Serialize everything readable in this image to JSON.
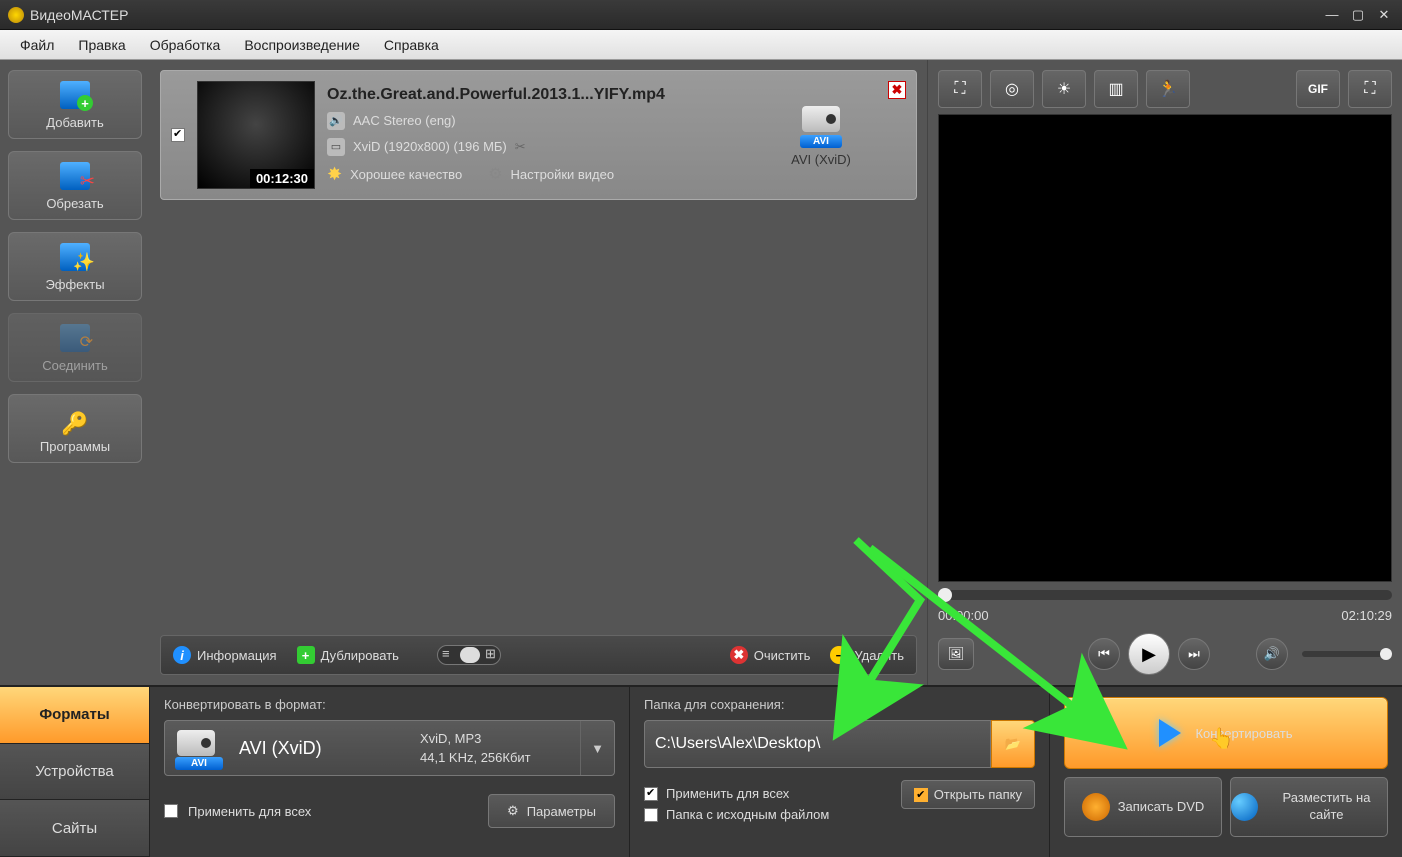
{
  "app": {
    "title": "ВидеоМАСТЕР"
  },
  "menu": {
    "file": "Файл",
    "edit": "Правка",
    "process": "Обработка",
    "playback": "Воспроизведение",
    "help": "Справка"
  },
  "sidebar": {
    "add": "Добавить",
    "cut": "Обрезать",
    "effects": "Эффекты",
    "join": "Соединить",
    "programs": "Программы"
  },
  "file": {
    "title": "Oz.the.Great.and.Powerful.2013.1...YIFY.mp4",
    "duration": "00:12:30",
    "audio": "AAC Stereo (eng)",
    "video": "XviD (1920x800) (196 МБ)",
    "quality": "Хорошее качество",
    "settings": "Настройки видео",
    "format_label": "AVI (XviD)",
    "format_badge": "AVI"
  },
  "bottombar": {
    "info": "Информация",
    "duplicate": "Дублировать",
    "clear": "Очистить",
    "delete": "Удалить"
  },
  "preview": {
    "current_time": "00:00:00",
    "total_time": "02:10:29"
  },
  "tabs": {
    "formats": "Форматы",
    "devices": "Устройства",
    "sites": "Сайты"
  },
  "format_panel": {
    "label": "Конвертировать в формат:",
    "selected_name": "AVI (XviD)",
    "selected_badge": "AVI",
    "detail1": "XviD, MP3",
    "detail2": "44,1 KHz, 256Кбит",
    "apply_all": "Применить для всех",
    "params": "Параметры"
  },
  "save_panel": {
    "label": "Папка для сохранения:",
    "path": "C:\\Users\\Alex\\Desktop\\",
    "apply_all": "Применить для всех",
    "same_folder": "Папка с исходным файлом",
    "open_folder": "Открыть папку"
  },
  "actions": {
    "convert": "Конвертировать",
    "burn_dvd": "Записать DVD",
    "publish": "Разместить на сайте"
  },
  "ptoolbar": {
    "gif": "GIF"
  }
}
